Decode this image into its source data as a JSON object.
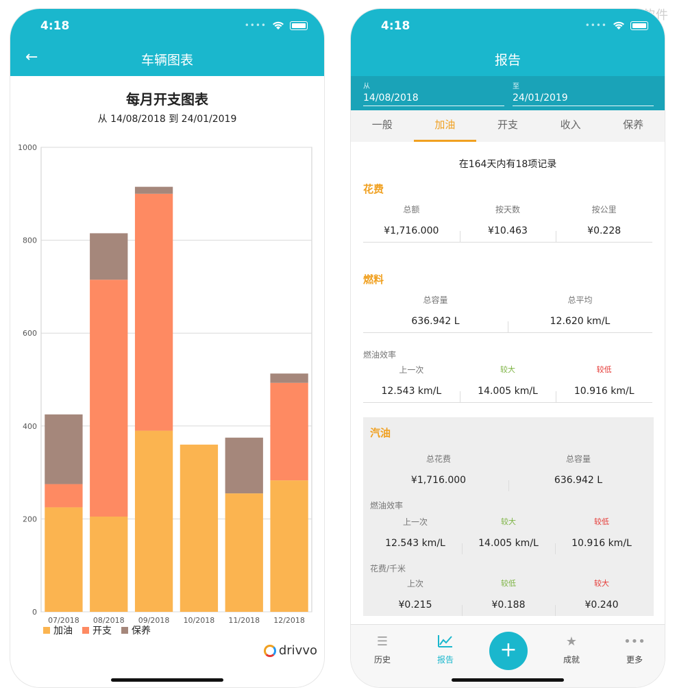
{
  "watermark": "小众软件",
  "left": {
    "status_time": "4:18",
    "nav_title": "车辆图表",
    "chart_title": "每月开支图表",
    "chart_subtitle": "从 14/08/2018 到 24/01/2019",
    "brand": "drivvo"
  },
  "chart_data": {
    "type": "bar",
    "stacked": true,
    "categories": [
      "07/2018",
      "08/2018",
      "09/2018",
      "10/2018",
      "11/2018",
      "12/2018"
    ],
    "series": [
      {
        "name": "加油",
        "color": "#fbb450",
        "values": [
          225,
          205,
          390,
          360,
          255,
          283
        ]
      },
      {
        "name": "开支",
        "color": "#fe8a62",
        "values": [
          50,
          510,
          510,
          0,
          0,
          210
        ]
      },
      {
        "name": "保养",
        "color": "#a5877b",
        "values": [
          150,
          100,
          15,
          0,
          120,
          20
        ]
      }
    ],
    "ylim": [
      0,
      1000
    ],
    "yticks": [
      0,
      200,
      400,
      600,
      800,
      1000
    ],
    "grid": true,
    "legend": "bottom-left"
  },
  "right": {
    "status_time": "4:18",
    "nav_title": "报告",
    "from_label": "从",
    "from_value": "14/08/2018",
    "to_label": "至",
    "to_value": "24/01/2019",
    "tabs": [
      "一般",
      "加油",
      "开支",
      "收入",
      "保养"
    ],
    "active_tab": "加油",
    "summary": "在164天内有18项记录",
    "cost": {
      "title": "花费",
      "labels": [
        "总额",
        "按天数",
        "按公里"
      ],
      "values": [
        "¥1,716.000",
        "¥10.463",
        "¥0.228"
      ]
    },
    "fuel": {
      "title": "燃料",
      "labels": [
        "总容量",
        "总平均"
      ],
      "values": [
        "636.942 L",
        "12.620 km/L"
      ],
      "eff_title": "燃油效率",
      "eff_labels": [
        "上一次",
        "较大",
        "较低"
      ],
      "eff_values": [
        "12.543 km/L",
        "14.005 km/L",
        "10.916 km/L"
      ]
    },
    "petrol": {
      "title": "汽油",
      "labels": [
        "总花费",
        "总容量"
      ],
      "values": [
        "¥1,716.000",
        "636.942 L"
      ],
      "eff_title": "燃油效率",
      "eff_labels": [
        "上一次",
        "较大",
        "较低"
      ],
      "eff_values": [
        "12.543 km/L",
        "14.005 km/L",
        "10.916 km/L"
      ],
      "cpk_title": "花费/千米",
      "cpk_labels": [
        "上次",
        "较低",
        "较大"
      ],
      "cpk_values": [
        "¥0.215",
        "¥0.188",
        "¥0.240"
      ]
    },
    "tabbar": [
      "历史",
      "报告",
      "+",
      "成就",
      "更多"
    ]
  },
  "colors": {
    "primary": "#1ab7cd",
    "accent": "#f0a020"
  }
}
